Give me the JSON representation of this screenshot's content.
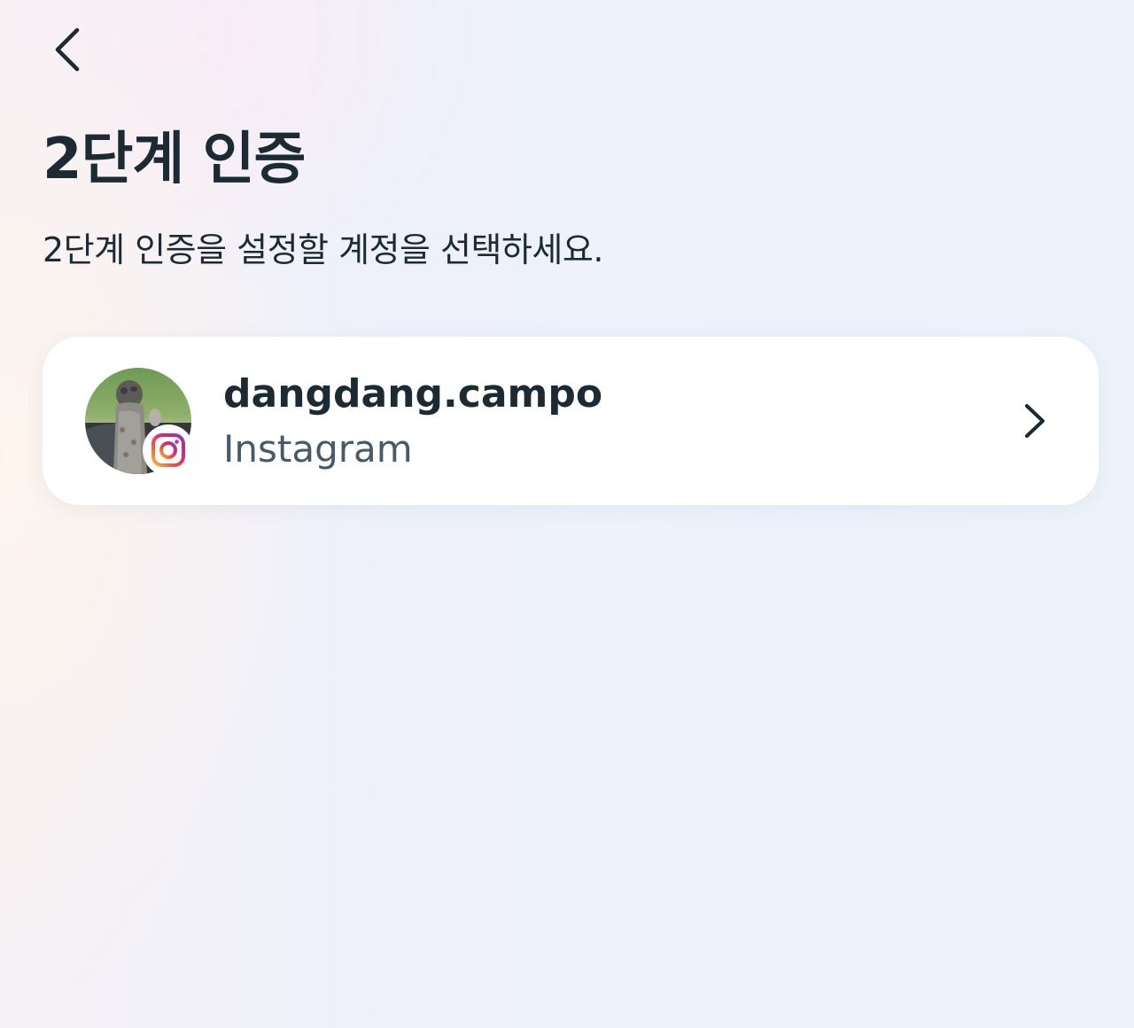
{
  "header": {
    "back_icon": "chevron-left-icon",
    "title": "2단계 인증",
    "subtitle": "2단계 인증을 설정할 계정을 선택하세요."
  },
  "accounts": [
    {
      "username": "dangdang.campo",
      "platform": "Instagram",
      "avatar_icon": "profile-photo",
      "badge_icon": "instagram-icon",
      "action_icon": "chevron-right-icon"
    }
  ],
  "colors": {
    "text_primary": "#1c2b33",
    "text_secondary": "#465a69",
    "card_background": "#ffffff"
  }
}
